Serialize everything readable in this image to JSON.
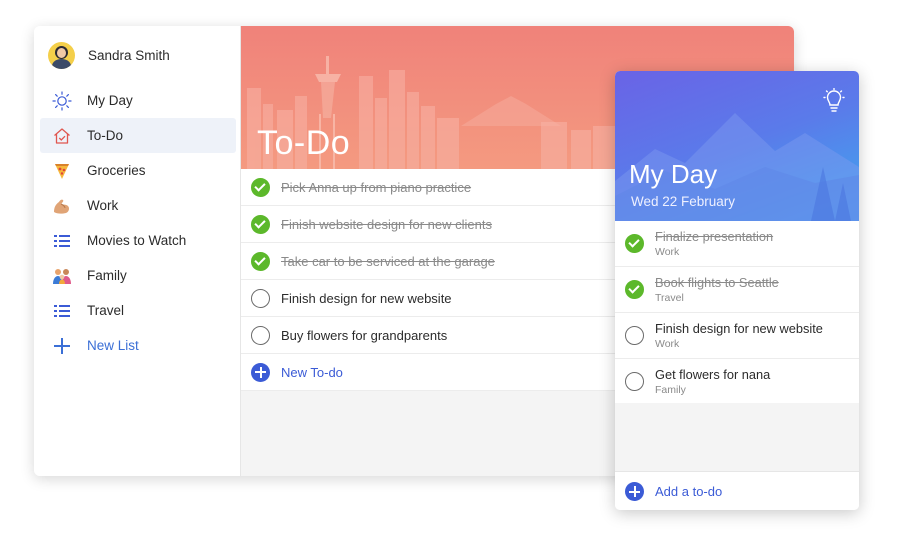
{
  "sidebar": {
    "user_name": "Sandra Smith",
    "items": [
      {
        "label": "My Day",
        "icon": "sun-icon"
      },
      {
        "label": "To-Do",
        "icon": "home-icon"
      },
      {
        "label": "Groceries",
        "icon": "pizza-icon"
      },
      {
        "label": "Work",
        "icon": "muscle-icon"
      },
      {
        "label": "Movies to Watch",
        "icon": "list-icon"
      },
      {
        "label": "Family",
        "icon": "family-icon"
      },
      {
        "label": "Travel",
        "icon": "list-icon"
      }
    ],
    "new_list_label": "New List"
  },
  "main": {
    "title": "To-Do",
    "tasks": [
      {
        "text": "Pick Anna up from piano practice",
        "done": true
      },
      {
        "text": "Finish website design for new clients",
        "done": true
      },
      {
        "text": "Take car to be serviced at the garage",
        "done": true
      },
      {
        "text": "Finish design for new website",
        "done": false
      },
      {
        "text": "Buy flowers for grandparents",
        "done": false
      }
    ],
    "add_label": "New To-do"
  },
  "myday": {
    "title": "My Day",
    "date": "Wed 22 February",
    "tasks": [
      {
        "title": "Finalize presentation",
        "list": "Work",
        "done": true
      },
      {
        "title": "Book flights to Seattle",
        "list": "Travel",
        "done": true
      },
      {
        "title": "Finish design for new website",
        "list": "Work",
        "done": false
      },
      {
        "title": "Get flowers for nana",
        "list": "Family",
        "done": false
      }
    ],
    "add_label": "Add a to-do"
  },
  "colors": {
    "accent": "#3b5bd6",
    "done_green": "#5cb82b",
    "todo_banner": "#f0827a",
    "myday_banner": "#5a7bea"
  }
}
